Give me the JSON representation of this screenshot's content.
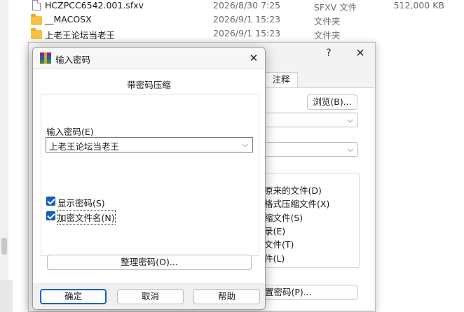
{
  "explorer": {
    "files": [
      {
        "name": "HCZPCC6542.001.sfxv",
        "date": "2026/8/30 7:25",
        "type": "SFXV 文件",
        "size": "512,000 KB",
        "icon": "document-icon"
      },
      {
        "name": "__MACOSX",
        "date": "2026/9/1 15:23",
        "type": "文件夹",
        "size": "",
        "icon": "folder-icon"
      },
      {
        "name": "上老王论坛当老王",
        "date": "2026/9/1 15:23",
        "type": "文件夹",
        "size": "",
        "icon": "folder-icon"
      }
    ]
  },
  "archive_dialog": {
    "help_glyph": "?",
    "close_glyph": "✕",
    "tab_comment": "注释",
    "browse_button": "浏览(B)...",
    "options": [
      "原来的文件(D)",
      "格式压缩文件(X)",
      "缩文件(S)",
      "录(E)",
      "文件(T)",
      "件(L)"
    ],
    "set_password_button": "置密码(P)..."
  },
  "password_dialog": {
    "title": "输入密码",
    "close_glyph": "✕",
    "heading": "带密码压缩",
    "password_label": "输入密码(E)",
    "password_value": "上老王论坛当老王",
    "show_password": {
      "label": "显示密码(S)",
      "checked": true
    },
    "encrypt_filenames": {
      "label": "加密文件名(N)",
      "checked": true
    },
    "organize_button": "整理密码(O)...",
    "ok_button": "确定",
    "cancel_button": "取消",
    "help_button": "帮助"
  },
  "colors": {
    "accent": "#0f62c5",
    "folder": "#f6c244",
    "dialog_bg": "#f0f0f0"
  }
}
